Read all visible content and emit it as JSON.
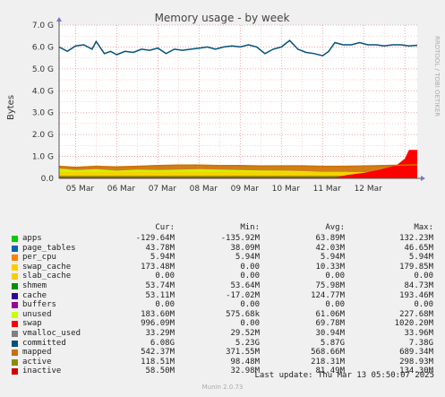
{
  "chart_data": {
    "type": "area",
    "title": "Memory usage - by week",
    "ylabel": "Bytes",
    "side_text": "RRDTOOL / TOBI OETIKER",
    "ylim": [
      0,
      7.0
    ],
    "y_ticks": [
      "0.0",
      "1.0 G",
      "2.0 G",
      "3.0 G",
      "4.0 G",
      "5.0 G",
      "6.0 G",
      "7.0 G"
    ],
    "x_ticks": [
      "05 Mar",
      "06 Mar",
      "07 Mar",
      "08 Mar",
      "09 Mar",
      "10 Mar",
      "11 Mar",
      "12 Mar"
    ],
    "x_range_days": [
      4.6,
      13.3
    ],
    "series": [
      {
        "name": "committed",
        "color": "#00527a",
        "x": [
          4.6,
          4.8,
          5.0,
          5.2,
          5.4,
          5.5,
          5.7,
          5.85,
          6.0,
          6.2,
          6.4,
          6.6,
          6.8,
          7.0,
          7.2,
          7.4,
          7.6,
          7.8,
          8.0,
          8.2,
          8.4,
          8.6,
          8.8,
          9.0,
          9.2,
          9.4,
          9.6,
          9.8,
          10.0,
          10.2,
          10.4,
          10.6,
          10.8,
          11.0,
          11.15,
          11.3,
          11.5,
          11.7,
          11.9,
          12.1,
          12.3,
          12.5,
          12.7,
          12.9,
          13.1,
          13.3
        ],
        "y": [
          6.0,
          5.8,
          6.05,
          6.1,
          5.9,
          6.25,
          5.7,
          5.8,
          5.65,
          5.8,
          5.75,
          5.9,
          5.85,
          5.95,
          5.7,
          5.9,
          5.85,
          5.9,
          5.95,
          6.0,
          5.9,
          6.0,
          6.05,
          6.0,
          6.1,
          6.0,
          5.7,
          5.9,
          6.0,
          6.3,
          5.9,
          5.75,
          5.7,
          5.6,
          5.8,
          6.2,
          6.1,
          6.1,
          6.2,
          6.1,
          6.1,
          6.05,
          6.1,
          6.1,
          6.05,
          6.08
        ]
      },
      {
        "name": "swap",
        "color": "#ff0000",
        "x": [
          11.2,
          11.6,
          12.0,
          12.4,
          12.8,
          13.0,
          13.1,
          13.3
        ],
        "y": [
          0.0,
          0.15,
          0.25,
          0.4,
          0.6,
          0.9,
          1.3,
          1.3
        ]
      },
      {
        "name": "unused",
        "color": "#ccff00",
        "x": [
          4.6,
          5.0,
          5.5,
          6.0,
          6.5,
          7.0,
          7.5,
          8.0,
          8.5,
          9.0,
          9.5,
          10.0,
          10.5,
          11.0,
          11.5,
          12.0,
          12.5,
          13.0,
          13.3
        ],
        "y": [
          0.45,
          0.38,
          0.42,
          0.35,
          0.4,
          0.38,
          0.4,
          0.42,
          0.4,
          0.38,
          0.36,
          0.35,
          0.33,
          0.3,
          0.3,
          0.28,
          0.35,
          0.4,
          0.42
        ]
      },
      {
        "name": "mapped",
        "color": "#cc7000",
        "x": [
          4.6,
          5.0,
          5.5,
          6.0,
          6.5,
          7.0,
          7.5,
          8.0,
          8.5,
          9.0,
          9.5,
          10.0,
          10.5,
          11.0,
          11.5,
          12.0,
          12.5,
          13.0,
          13.3
        ],
        "y": [
          0.55,
          0.5,
          0.55,
          0.52,
          0.55,
          0.58,
          0.6,
          0.6,
          0.58,
          0.58,
          0.56,
          0.57,
          0.57,
          0.55,
          0.55,
          0.56,
          0.58,
          0.6,
          0.62
        ]
      }
    ],
    "legend": {
      "headers": [
        "Cur:",
        "Min:",
        "Avg:",
        "Max:"
      ],
      "rows": [
        {
          "name": "apps",
          "color": "#00cc00",
          "cur": "-129.64M",
          "min": "-135.92M",
          "avg": "63.89M",
          "max": "132.23M"
        },
        {
          "name": "page_tables",
          "color": "#0066b3",
          "cur": "43.78M",
          "min": "38.09M",
          "avg": "42.03M",
          "max": "46.65M"
        },
        {
          "name": "per_cpu",
          "color": "#ff8000",
          "cur": "5.94M",
          "min": "5.94M",
          "avg": "5.94M",
          "max": "5.94M"
        },
        {
          "name": "swap_cache",
          "color": "#ffcc00",
          "cur": "173.48M",
          "min": "0.00",
          "avg": "10.33M",
          "max": "179.85M"
        },
        {
          "name": "slab_cache",
          "color": "#ffcc00",
          "cur": "0.00",
          "min": "0.00",
          "avg": "0.00",
          "max": "0.00"
        },
        {
          "name": "shmem",
          "color": "#008f00",
          "cur": "53.74M",
          "min": "53.64M",
          "avg": "75.98M",
          "max": "84.73M"
        },
        {
          "name": "cache",
          "color": "#330099",
          "cur": "53.11M",
          "min": "-17.02M",
          "avg": "124.77M",
          "max": "193.46M"
        },
        {
          "name": "buffers",
          "color": "#990099",
          "cur": "0.00",
          "min": "0.00",
          "avg": "0.00",
          "max": "0.00"
        },
        {
          "name": "unused",
          "color": "#ccff00",
          "cur": "183.60M",
          "min": "575.68k",
          "avg": "61.06M",
          "max": "227.68M"
        },
        {
          "name": "swap",
          "color": "#ff0000",
          "cur": "996.09M",
          "min": "0.00",
          "avg": "69.78M",
          "max": "1020.20M"
        },
        {
          "name": "vmalloc_used",
          "color": "#808080",
          "cur": "33.29M",
          "min": "29.52M",
          "avg": "30.94M",
          "max": "33.96M"
        },
        {
          "name": "committed",
          "color": "#00527a",
          "cur": "6.08G",
          "min": "5.23G",
          "avg": "5.87G",
          "max": "7.38G"
        },
        {
          "name": "mapped",
          "color": "#cc7000",
          "cur": "542.37M",
          "min": "371.55M",
          "avg": "568.66M",
          "max": "689.34M"
        },
        {
          "name": "active",
          "color": "#8c8c00",
          "cur": "118.51M",
          "min": "98.48M",
          "avg": "218.31M",
          "max": "298.93M"
        },
        {
          "name": "inactive",
          "color": "#cc0000",
          "cur": "58.50M",
          "min": "32.98M",
          "avg": "81.49M",
          "max": "134.30M"
        }
      ]
    },
    "last_update": "Last update: Thu Mar 13 05:50:07 2025",
    "footer": "Munin 2.0.73"
  }
}
